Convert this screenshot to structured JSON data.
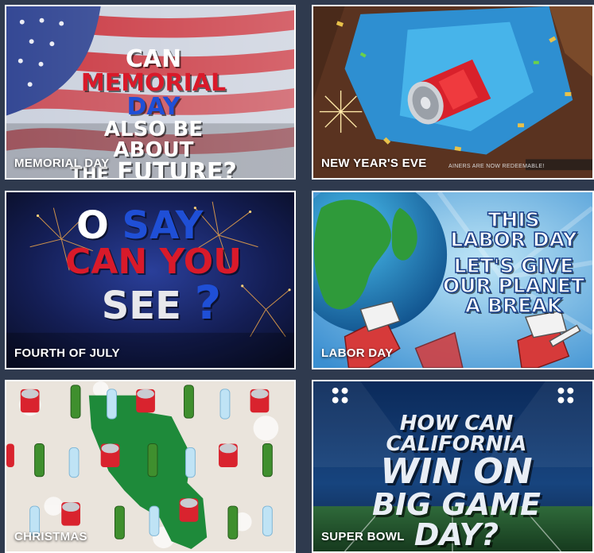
{
  "tiles": [
    {
      "caption": "MEMORIAL DAY",
      "headline": {
        "line1": "CAN",
        "line2a": "MEMORIAL",
        "line2b": "DAY",
        "line3": "ALSO BE ABOUT",
        "line4a": "THE",
        "line4b": "FUTURE?"
      }
    },
    {
      "caption": "NEW YEAR'S EVE",
      "note": "AINERS ARE NOW REDEEMABLE!"
    },
    {
      "caption": "FOURTH OF JULY",
      "headline": {
        "line1a": "O",
        "line1b": "SAY",
        "line2": "CAN YOU",
        "line3a": "SEE",
        "line3b": "?"
      }
    },
    {
      "caption": "LABOR DAY",
      "headline": {
        "line1": "THIS",
        "line2": "LABOR DAY",
        "line3": "LET'S GIVE",
        "line4": "OUR PLANET",
        "line5": "A BREAK"
      }
    },
    {
      "caption": "CHRISTMAS"
    },
    {
      "caption": "SUPER BOWL",
      "headline": {
        "line1": "HOW CAN CALIFORNIA",
        "line2": "WIN ON",
        "line3": "BIG GAME DAY?"
      }
    }
  ],
  "colors": {
    "background": "#2f3a4e",
    "tile_border": "#ffffff",
    "patriot_red": "#d91a2a",
    "patriot_blue": "#1f4fd6",
    "caption_text": "#ffffff"
  }
}
